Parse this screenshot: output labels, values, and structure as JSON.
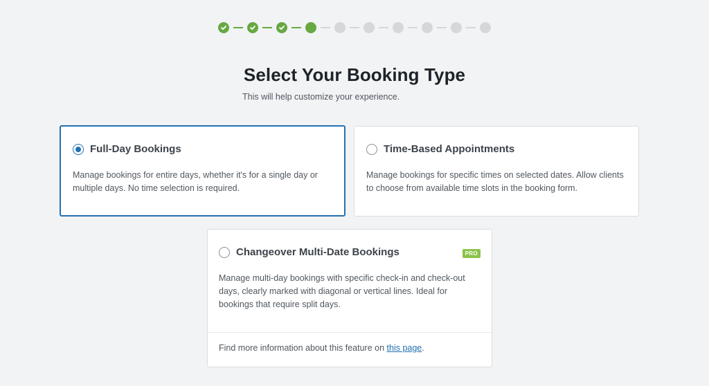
{
  "steps": [
    {
      "state": "done",
      "icon": "check-icon"
    },
    {
      "state": "done",
      "icon": "check-icon"
    },
    {
      "state": "done",
      "icon": "check-icon"
    },
    {
      "state": "current"
    },
    {
      "state": "todo"
    },
    {
      "state": "todo"
    },
    {
      "state": "todo"
    },
    {
      "state": "todo"
    },
    {
      "state": "todo"
    },
    {
      "state": "todo"
    }
  ],
  "header": {
    "title": "Select Your Booking Type",
    "subtitle": "This will help customize your experience."
  },
  "options": [
    {
      "id": "full-day",
      "title": "Full-Day Bookings",
      "description": "Manage bookings for entire days, whether it's for a single day or multiple days. No time selection is required.",
      "selected": true
    },
    {
      "id": "time-based",
      "title": "Time-Based Appointments",
      "description": "Manage bookings for specific times on selected dates. Allow clients to choose from available time slots in the booking form.",
      "selected": false
    },
    {
      "id": "changeover",
      "title": "Changeover Multi-Date Bookings",
      "badge": "PRO",
      "description": "Manage multi-day bookings with specific check-in and check-out days, clearly marked with diagonal or vertical lines. Ideal for bookings that require split days.",
      "selected": false,
      "footer_text": "Find more information about this feature on",
      "footer_link": "this page",
      "footer_suffix": "."
    }
  ],
  "colors": {
    "accent": "#2271b1",
    "step_complete": "#68a843",
    "step_pending": "#d5d7d9",
    "badge": "#8bc34a",
    "background": "#f1f3f5"
  }
}
